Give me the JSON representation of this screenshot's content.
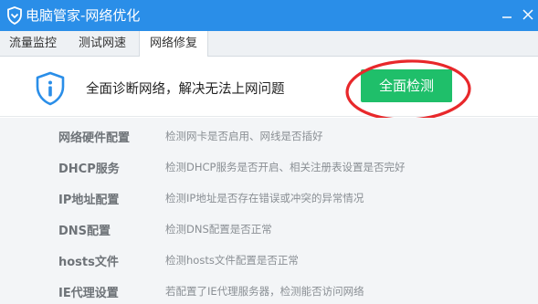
{
  "window": {
    "title": "电脑管家-网络优化",
    "app_icon": "shield-logo-icon",
    "controls": [
      "minimize-icon",
      "close-icon"
    ]
  },
  "tabs": [
    {
      "label": "流量监控",
      "active": false
    },
    {
      "label": "测试网速",
      "active": false
    },
    {
      "label": "网络修复",
      "active": true
    }
  ],
  "hero": {
    "icon": "shield-info-icon",
    "text": "全面诊断网络，解决无法上网问题",
    "button_label": "全面检测",
    "annotation": "red-circle-highlight"
  },
  "items": [
    {
      "name": "网络硬件配置",
      "desc": "检测网卡是否启用、网线是否插好"
    },
    {
      "name": "DHCP服务",
      "desc": "检测DHCP服务是否开启、相关注册表设置是否完好"
    },
    {
      "name": "IP地址配置",
      "desc": "检测IP地址是否存在错误或冲突的异常情况"
    },
    {
      "name": "DNS配置",
      "desc": "检测DNS配置是否正常"
    },
    {
      "name": "hosts文件",
      "desc": "检测hosts文件配置是否正常"
    },
    {
      "name": "IE代理设置",
      "desc": "若配置了IE代理服务器，检测能否访问网络"
    }
  ],
  "colors": {
    "titlebar": "#2a8ee8",
    "accent_button": "#1fbf6a",
    "annotation_ring": "#e8282b",
    "list_bg": "#f3f5f7"
  }
}
